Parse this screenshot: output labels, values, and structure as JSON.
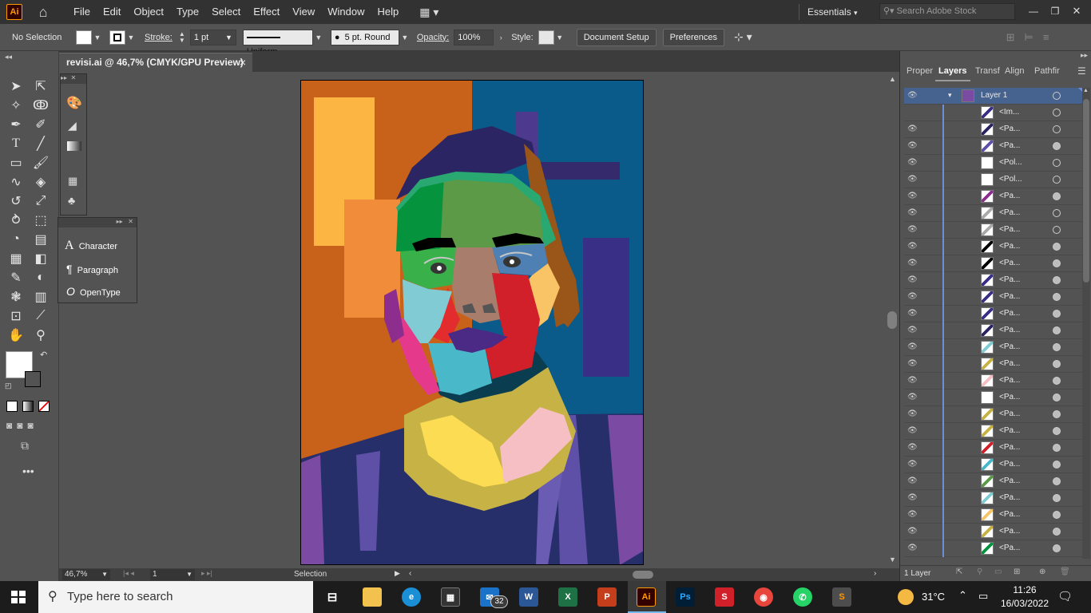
{
  "menubar": {
    "app_logo": "Ai",
    "items": [
      "File",
      "Edit",
      "Object",
      "Type",
      "Select",
      "Effect",
      "View",
      "Window",
      "Help"
    ],
    "workspace": "Essentials",
    "search_placeholder": "Search Adobe Stock"
  },
  "control": {
    "selection": "No Selection",
    "stroke_label": "Stroke:",
    "stroke_weight": "1 pt",
    "stroke_profile": "Uniform",
    "brush": "5 pt. Round",
    "opacity_label": "Opacity:",
    "opacity_value": "100%",
    "style_label": "Style:",
    "document_setup": "Document Setup",
    "preferences": "Preferences"
  },
  "document": {
    "tab_title": "revisi.ai @ 46,7% (CMYK/GPU Preview)",
    "close": "×"
  },
  "type_panel": {
    "items": [
      "Character",
      "Paragraph",
      "OpenType"
    ]
  },
  "layers": {
    "tabs": [
      "Proper",
      "Layers",
      "Transf",
      "Align",
      "Pathfir"
    ],
    "active_tab": "Layers",
    "layer_name": "Layer 1",
    "rows": [
      "<Im...",
      "<Pa...",
      "<Pa...",
      "<Pol...",
      "<Pol...",
      "<Pa...",
      "<Pa...",
      "<Pa...",
      "<Pa...",
      "<Pa...",
      "<Pa...",
      "<Pa...",
      "<Pa...",
      "<Pa...",
      "<Pa...",
      "<Pa...",
      "<Pa...",
      "<Pa...",
      "<Pa...",
      "<Pa...",
      "<Pa...",
      "<Pa...",
      "<Pa...",
      "<Pa...",
      "<Pa...",
      "<Pa...",
      "<Pa..."
    ],
    "footer_count": "1 Layer"
  },
  "status": {
    "zoom": "46,7%",
    "artboard": "1",
    "tool": "Selection"
  },
  "taskbar": {
    "search_placeholder": "Type here to search",
    "mail_badge": "32",
    "temperature": "31°C",
    "time": "11:26",
    "date": "16/03/2022"
  },
  "colors": {
    "accent": "#6f8fd4",
    "artboard_bg_orange": "#c8621a",
    "artboard_bg_blue": "#0a5b8a"
  }
}
